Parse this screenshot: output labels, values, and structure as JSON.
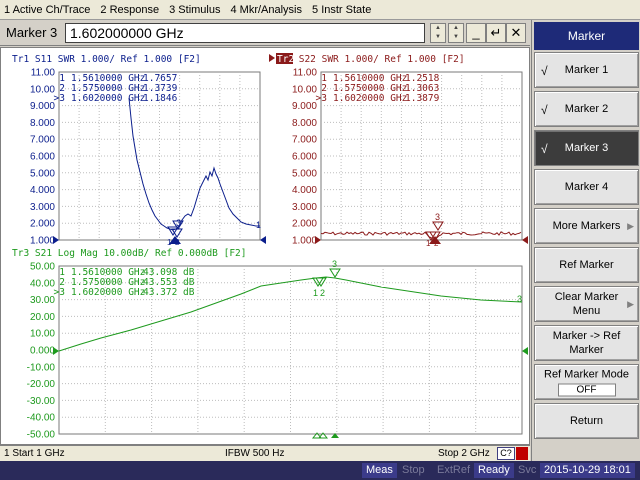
{
  "menu": [
    "1 Active Ch/Trace",
    "2 Response",
    "3 Stimulus",
    "4 Mkr/Analysis",
    "5 Instr State"
  ],
  "entry": {
    "label": "Marker 3",
    "value": "1.602000000 GHz"
  },
  "softkeys": {
    "header": "Marker",
    "items": [
      {
        "label": "Marker 1",
        "checked": true,
        "active": false
      },
      {
        "label": "Marker 2",
        "checked": true,
        "active": false
      },
      {
        "label": "Marker 3",
        "checked": true,
        "active": true
      },
      {
        "label": "Marker 4",
        "checked": false,
        "active": false
      },
      {
        "label": "More Markers",
        "arrow": true
      },
      {
        "label": "Ref Marker"
      },
      {
        "label": "Clear Marker Menu",
        "arrow": true
      },
      {
        "label": "Marker -> Ref Marker"
      },
      {
        "label": "Ref Marker Mode",
        "value": "OFF"
      },
      {
        "label": "Return"
      }
    ]
  },
  "traces": {
    "tr1": {
      "title": "Tr1 S11 SWR 1.000/ Ref 1.000 [F2]",
      "color": "#0b1e8c",
      "y_ticks": [
        "11.00",
        "10.00",
        "9.000",
        "8.000",
        "7.000",
        "6.000",
        "5.000",
        "4.000",
        "3.000",
        "2.000",
        "1.000"
      ],
      "markers": [
        {
          "num": "1",
          "freq": "1.5610000 GHz",
          "val": "1.7657"
        },
        {
          "num": "2",
          "freq": "1.5750000 GHz",
          "val": "1.3739"
        },
        {
          "num": ">3",
          "freq": "1.6020000 GHz",
          "val": "1.1846"
        }
      ],
      "marker_labels": [
        "1",
        "2",
        "3"
      ]
    },
    "tr2": {
      "tag": "Tr2",
      "title": " S22 SWR 1.000/ Ref 1.000 [F2]",
      "color": "#8b1a1a",
      "y_ticks": [
        "11.00",
        "10.00",
        "9.000",
        "8.000",
        "7.000",
        "6.000",
        "5.000",
        "4.000",
        "3.000",
        "2.000",
        "1.000"
      ],
      "markers": [
        {
          "num": "1",
          "freq": "1.5610000 GHz",
          "val": "1.2518"
        },
        {
          "num": "2",
          "freq": "1.5750000 GHz",
          "val": "1.3063"
        },
        {
          "num": ">3",
          "freq": "1.6020000 GHz",
          "val": "1.3879"
        }
      ],
      "marker_labels": [
        "1",
        "2",
        "3"
      ]
    },
    "tr3": {
      "title": "Tr3 S21 Log Mag 10.00dB/ Ref 0.000dB [F2]",
      "color": "#1e9a1e",
      "y_ticks": [
        "50.00",
        "40.00",
        "30.00",
        "20.00",
        "10.00",
        "0.000",
        "-10.00",
        "-20.00",
        "-30.00",
        "-40.00",
        "-50.00"
      ],
      "markers": [
        {
          "num": "1",
          "freq": "1.5610000 GHz",
          "val": "43.098 dB"
        },
        {
          "num": "2",
          "freq": "1.5750000 GHz",
          "val": "43.553 dB"
        },
        {
          "num": ">3",
          "freq": "1.6020000 GHz",
          "val": "43.372 dB"
        }
      ],
      "marker_labels": [
        "1",
        "2",
        "3"
      ]
    }
  },
  "status": {
    "start": "1  Start 1 GHz",
    "ifbw": "IFBW 500 Hz",
    "stop": "Stop 2 GHz",
    "cal": "C?"
  },
  "bottom": {
    "meas": "Meas",
    "stop": "Stop",
    "extref": "ExtRef",
    "ready": "Ready",
    "svc": "Svc",
    "datetime": "2015-10-29 18:01"
  }
}
